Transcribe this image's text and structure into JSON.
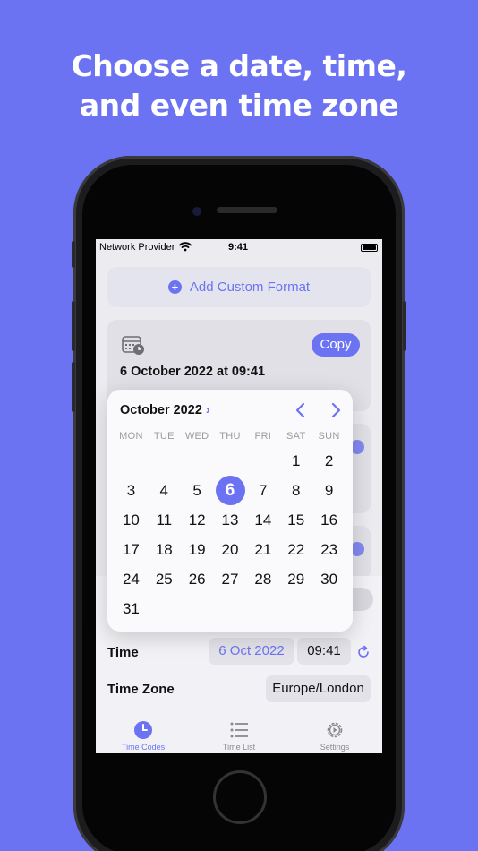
{
  "headline": {
    "line1": "Choose a date, time,",
    "line2": "and even time zone"
  },
  "status_bar": {
    "carrier": "Network Provider",
    "time": "9:41",
    "wifi_icon": "wifi-icon",
    "battery_icon": "battery-icon"
  },
  "add_custom_format": {
    "label": "Add Custom Format",
    "icon": "plus-circle-icon"
  },
  "format_card": {
    "icon": "calendar-clock-icon",
    "copy_label": "Copy",
    "value": "6 October 2022 at 09:41"
  },
  "calendar": {
    "month_label": "October 2022",
    "weekdays": [
      "MON",
      "TUE",
      "WED",
      "THU",
      "FRI",
      "SAT",
      "SUN"
    ],
    "weeks": [
      [
        "",
        "",
        "",
        "",
        "",
        "1",
        "2"
      ],
      [
        "3",
        "4",
        "5",
        "6",
        "7",
        "8",
        "9"
      ],
      [
        "10",
        "11",
        "12",
        "13",
        "14",
        "15",
        "16"
      ],
      [
        "17",
        "18",
        "19",
        "20",
        "21",
        "22",
        "23"
      ],
      [
        "24",
        "25",
        "26",
        "27",
        "28",
        "29",
        "30"
      ],
      [
        "31",
        "",
        "",
        "",
        "",
        "",
        ""
      ]
    ],
    "selected_day": "6"
  },
  "settings": {
    "time_label": "Time",
    "date_value": "6 Oct 2022",
    "time_value": "09:41",
    "timezone_label": "Time Zone",
    "timezone_value": "Europe/London"
  },
  "tabs": [
    {
      "label": "Time Codes",
      "icon": "clock-icon",
      "active": true
    },
    {
      "label": "Time List",
      "icon": "list-icon",
      "active": false
    },
    {
      "label": "Settings",
      "icon": "gear-icon",
      "active": false
    }
  ],
  "colors": {
    "accent": "#6b73f2",
    "background": "#6b73f2"
  }
}
